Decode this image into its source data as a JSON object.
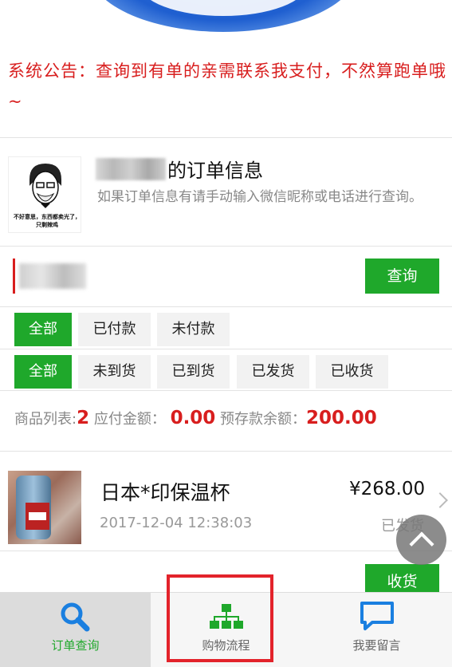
{
  "notice": "系统公告：查询到有单的亲需联系我支付，不然算跑单哦~",
  "header": {
    "title_suffix": "的订单信息",
    "hint": "如果订单信息有请手动输入微信昵称或电话进行查询。",
    "avatar_caption": "不好意思，东西都卖光了，只剩辣鸡"
  },
  "search": {
    "query_label": "查询"
  },
  "payment_tabs": [
    {
      "label": "全部",
      "active": true
    },
    {
      "label": "已付款",
      "active": false
    },
    {
      "label": "未付款",
      "active": false
    }
  ],
  "shipping_tabs": [
    {
      "label": "全部",
      "active": true
    },
    {
      "label": "未到货",
      "active": false
    },
    {
      "label": "已到货",
      "active": false
    },
    {
      "label": "已发货",
      "active": false
    },
    {
      "label": "已收货",
      "active": false
    }
  ],
  "stats": {
    "list_label": "商品列表:",
    "list_count": "2",
    "due_label": "应付金额：",
    "due_amount": "0.00",
    "deposit_label": "预存款余额：",
    "deposit_amount": "200.00"
  },
  "product": {
    "name": "日本*印保温杯",
    "price": "¥268.00",
    "date": "2017-12-04 12:38:03",
    "status": "已发货",
    "receive_label": "收货"
  },
  "tabbar": [
    {
      "label": "订单查询",
      "icon": "search-icon",
      "active": true
    },
    {
      "label": "购物流程",
      "icon": "sitemap-icon",
      "active": false
    },
    {
      "label": "我要留言",
      "icon": "message-icon",
      "active": false
    }
  ],
  "colors": {
    "accent_green": "#1fa82b",
    "notice_red": "#d81e1e",
    "highlight_red": "#e3232b"
  }
}
